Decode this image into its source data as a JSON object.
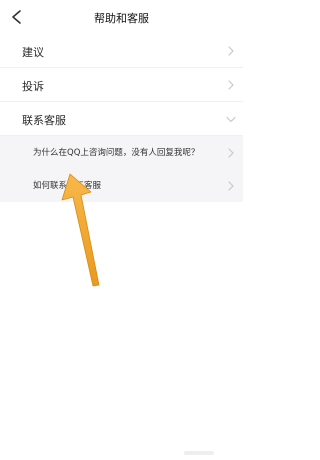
{
  "header": {
    "title": "帮助和客服",
    "back_icon": "chevron-left-icon"
  },
  "menu": {
    "items": [
      {
        "label": "建议",
        "icon": "chevron-right-icon"
      },
      {
        "label": "投诉",
        "icon": "chevron-right-icon"
      },
      {
        "label": "联系客服",
        "icon": "chevron-down-icon",
        "expanded": true
      }
    ],
    "subitems": [
      {
        "label": "为什么在QQ上咨询问题，没有人回复我呢？",
        "icon": "chevron-right-icon"
      },
      {
        "label": "如何联系人工客服",
        "icon": "chevron-right-icon"
      }
    ]
  },
  "annotation": {
    "arrow_color": "#f0a830",
    "arrow_icon": "pointer-arrow-icon"
  },
  "colors": {
    "background": "#ffffff",
    "sub_background": "#f5f5f7",
    "chevron": "#c8c8c8",
    "text": "#2a2a2a"
  }
}
